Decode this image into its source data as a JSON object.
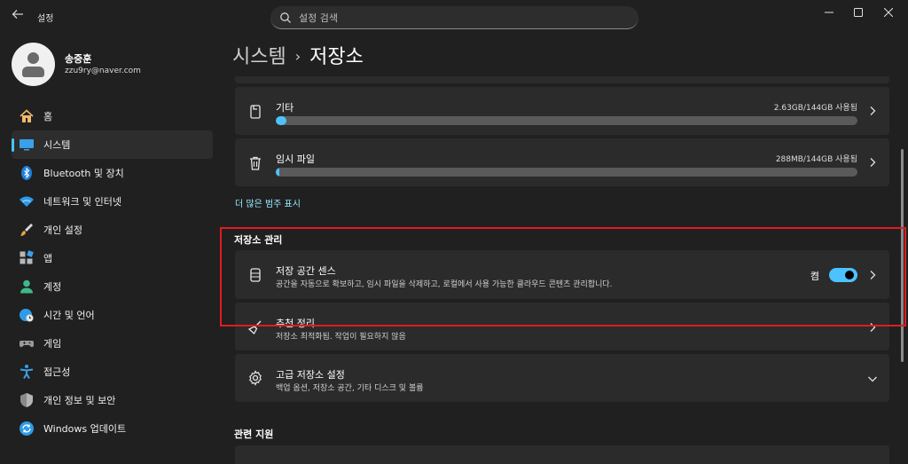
{
  "window": {
    "app_title": "설정",
    "search_placeholder": "설정 검색",
    "controls": [
      "minimize",
      "maximize",
      "close"
    ]
  },
  "user": {
    "name": "송중훈",
    "email": "zzu9ry@naver.com"
  },
  "sidebar": {
    "items": [
      {
        "label": "홈",
        "icon": "home-icon",
        "active": false
      },
      {
        "label": "시스템",
        "icon": "monitor-icon",
        "active": true
      },
      {
        "label": "Bluetooth 및 장치",
        "icon": "bluetooth-icon",
        "active": false
      },
      {
        "label": "네트워크 및 인터넷",
        "icon": "wifi-icon",
        "active": false
      },
      {
        "label": "개인 설정",
        "icon": "brush-icon",
        "active": false
      },
      {
        "label": "앱",
        "icon": "apps-icon",
        "active": false
      },
      {
        "label": "계정",
        "icon": "account-icon",
        "active": false
      },
      {
        "label": "시간 및 언어",
        "icon": "globe-clock-icon",
        "active": false
      },
      {
        "label": "게임",
        "icon": "gamepad-icon",
        "active": false
      },
      {
        "label": "접근성",
        "icon": "accessibility-icon",
        "active": false
      },
      {
        "label": "개인 정보 및 보안",
        "icon": "shield-icon",
        "active": false
      },
      {
        "label": "Windows 업데이트",
        "icon": "update-icon",
        "active": false
      }
    ]
  },
  "main": {
    "breadcrumb": {
      "parent": "시스템",
      "current": "저장소"
    },
    "categories": [
      {
        "title": "기타",
        "usage": "2.63GB/144GB 사용됨",
        "fraction": 0.018,
        "icon": "other-files-icon"
      },
      {
        "title": "임시 파일",
        "usage": "288MB/144GB 사용됨",
        "fraction": 0.003,
        "icon": "trash-icon"
      }
    ],
    "more_categories_link": "더 많은 범주 표시",
    "management": {
      "section_title": "저장소 관리",
      "storage_sense": {
        "title": "저장 공간 센스",
        "subtitle": "공간을 자동으로 확보하고, 임시 파일을 삭제하고, 로컬에서 사용 가능한 클라우드 콘텐츠 관리합니다.",
        "toggle_label": "켬",
        "toggle_on": true
      },
      "cleanup": {
        "title": "추천 정리",
        "subtitle": "저장소 최적화됨. 작업이 필요하지 않음"
      },
      "advanced": {
        "title": "고급 저장소 설정",
        "subtitle": "백업 옵션, 저장소 공간, 기타 디스크 및 볼륨"
      }
    },
    "related_title": "관련 지원"
  },
  "colors": {
    "accent": "#4cc2ff",
    "highlight_box": "#e11b22",
    "background": "#202020",
    "card": "#2b2b2b"
  }
}
